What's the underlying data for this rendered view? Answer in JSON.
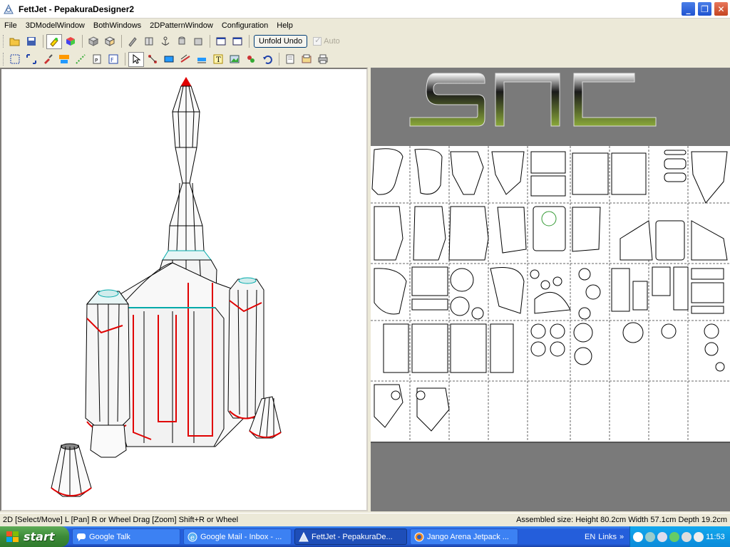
{
  "window": {
    "title": "FettJet - PepakuraDesigner2",
    "minimize_label": "_",
    "maximize_label": "❐",
    "close_label": "✕"
  },
  "menu": [
    "File",
    "3DModelWindow",
    "BothWindows",
    "2DPatternWindow",
    "Configuration",
    "Help"
  ],
  "toolbar1": {
    "unfold_undo_label": "Unfold Undo",
    "auto_label": "Auto",
    "auto_checked": true,
    "auto_enabled": false
  },
  "canvas_2d": {
    "logo_text": "SPC",
    "page_count_visible": 36
  },
  "statusbar": {
    "mode_hint": "2D [Select/Move] L [Pan] R or Wheel Drag [Zoom] Shift+R or Wheel",
    "assembled_size": "Assembled size: Height 80.2cm Width 57.1cm Depth 19.2cm"
  },
  "taskbar": {
    "start_label": "start",
    "tasks": [
      {
        "label": "Google Talk",
        "active": false,
        "icon": "chat-icon"
      },
      {
        "label": "Google Mail - Inbox - ...",
        "active": false,
        "icon": "ie-icon"
      },
      {
        "label": "FettJet - PepakuraDe...",
        "active": true,
        "icon": "pepakura-icon"
      },
      {
        "label": "Jango Arena Jetpack ...",
        "active": false,
        "icon": "firefox-icon"
      }
    ],
    "language": "EN",
    "links_label": "Links",
    "clock": "11:53"
  },
  "colors": {
    "accent_red": "#e00000",
    "logo_green": "#6a8a2a",
    "taskbar_blue": "#245edb"
  }
}
